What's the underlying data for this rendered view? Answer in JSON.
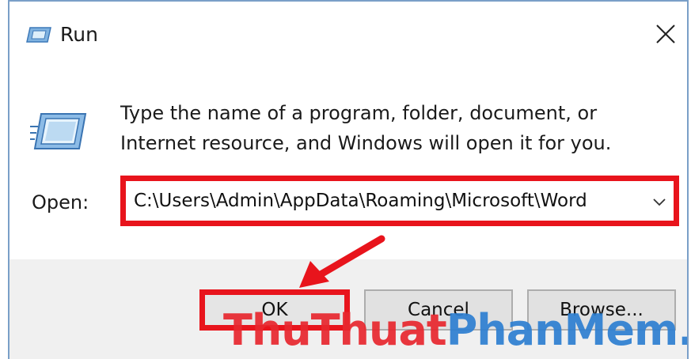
{
  "window": {
    "title": "Run",
    "close_icon": "close-icon"
  },
  "body": {
    "icon": "run-icon",
    "description": "Type the name of a program, folder, document, or Internet resource, and Windows will open it for you."
  },
  "open": {
    "label": "Open:",
    "value": "C:\\Users\\Admin\\AppData\\Roaming\\Microsoft\\Word"
  },
  "buttons": {
    "ok": "OK",
    "cancel": "Cancel",
    "browse": "Browse..."
  },
  "watermark": {
    "part1": "ThuThuat",
    "part2": "PhanMem",
    "part3": ".vn"
  },
  "colors": {
    "highlight": "#e8141c",
    "watermark_red": "#e8272e",
    "watermark_blue": "#2d7fd1"
  }
}
